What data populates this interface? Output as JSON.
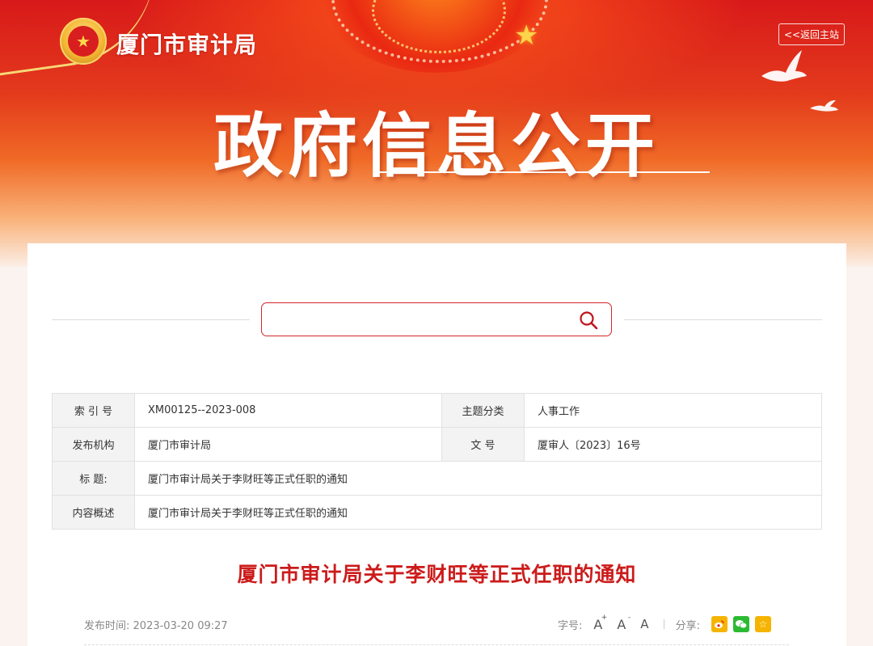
{
  "header": {
    "site_name": "厦门市审计局",
    "back_link": "<<返回主站",
    "banner_title": "政府信息公开"
  },
  "search": {
    "placeholder": "",
    "value": ""
  },
  "meta": {
    "rows": [
      {
        "label": "索 引 号",
        "value": "XM00125--2023-008",
        "label2": "主题分类",
        "value2": "人事工作"
      },
      {
        "label": "发布机构",
        "value": "厦门市审计局",
        "label2": "文  号",
        "value2": "厦审人〔2023〕16号"
      },
      {
        "label": "标  题:",
        "value": "厦门市审计局关于李财旺等正式任职的通知"
      },
      {
        "label": "内容概述",
        "value": "厦门市审计局关于李财旺等正式任职的通知"
      }
    ]
  },
  "article": {
    "title": "厦门市审计局关于李财旺等正式任职的通知",
    "publish_label": "发布时间:",
    "publish_time": "2023-03-20 09:27",
    "font_size_label": "字号:",
    "font_large": "A",
    "font_medium": "A",
    "font_small": "A",
    "share_label": "分享:"
  },
  "colors": {
    "accent_red": "#cc1b1b",
    "weibo": "#f5b400",
    "wechat": "#2dba33",
    "favorite": "#f5b400"
  },
  "icons": {
    "search": "search-icon",
    "weibo": "weibo-icon",
    "wechat": "wechat-icon",
    "favorite": "star-icon"
  }
}
